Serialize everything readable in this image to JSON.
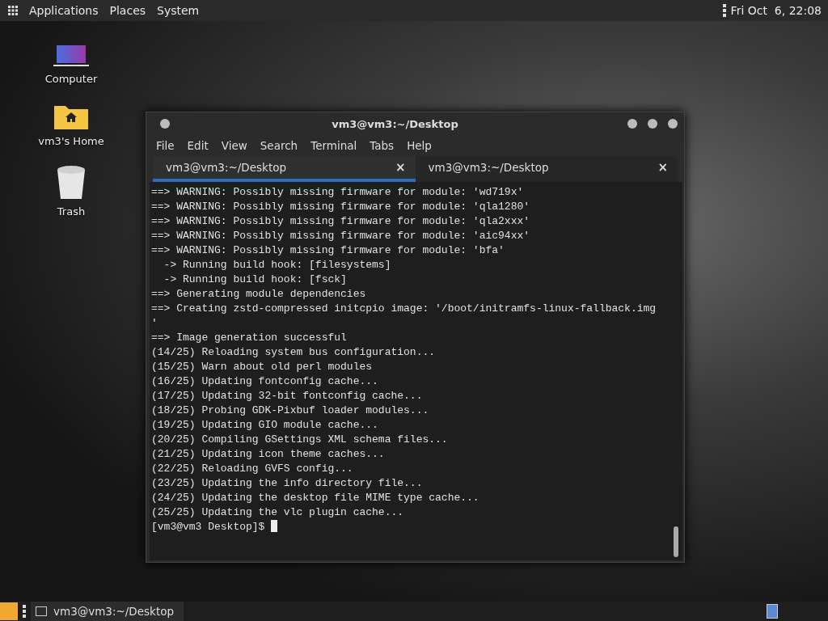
{
  "top_panel": {
    "menus": [
      "Applications",
      "Places",
      "System"
    ],
    "clock": "Fri Oct  6, 22:08"
  },
  "desktop_icons": [
    {
      "label": "Computer",
      "kind": "computer"
    },
    {
      "label": "vm3's Home",
      "kind": "home"
    },
    {
      "label": "Trash",
      "kind": "trash"
    }
  ],
  "window": {
    "title": "vm3@vm3:~/Desktop",
    "menu": [
      "File",
      "Edit",
      "View",
      "Search",
      "Terminal",
      "Tabs",
      "Help"
    ],
    "tabs": [
      {
        "label": "vm3@vm3:~/Desktop",
        "close": "×",
        "selected": true
      },
      {
        "label": "vm3@vm3:~/Desktop",
        "close": "×",
        "selected": false
      }
    ],
    "lines": [
      "==> WARNING: Possibly missing firmware for module: 'wd719x'",
      "==> WARNING: Possibly missing firmware for module: 'qla1280'",
      "==> WARNING: Possibly missing firmware for module: 'qla2xxx'",
      "==> WARNING: Possibly missing firmware for module: 'aic94xx'",
      "==> WARNING: Possibly missing firmware for module: 'bfa'",
      "  -> Running build hook: [filesystems]",
      "  -> Running build hook: [fsck]",
      "==> Generating module dependencies",
      "==> Creating zstd-compressed initcpio image: '/boot/initramfs-linux-fallback.img",
      "'",
      "==> Image generation successful",
      "(14/25) Reloading system bus configuration...",
      "(15/25) Warn about old perl modules",
      "(16/25) Updating fontconfig cache...",
      "(17/25) Updating 32-bit fontconfig cache...",
      "(18/25) Probing GDK-Pixbuf loader modules...",
      "(19/25) Updating GIO module cache...",
      "(20/25) Compiling GSettings XML schema files...",
      "(21/25) Updating icon theme caches...",
      "(22/25) Reloading GVFS config...",
      "(23/25) Updating the info directory file...",
      "(24/25) Updating the desktop file MIME type cache...",
      "(25/25) Updating the vlc plugin cache..."
    ],
    "prompt": "[vm3@vm3 Desktop]$"
  },
  "taskbar": {
    "items": [
      {
        "label": "vm3@vm3:~/Desktop",
        "selected": false
      }
    ]
  }
}
